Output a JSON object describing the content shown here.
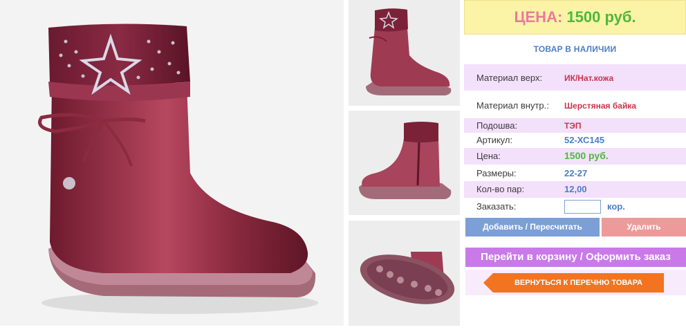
{
  "product": {
    "images": {
      "main_alt": "boot-main-photo",
      "thumbs": [
        "boot-side-view",
        "boot-inner-zip-view",
        "boot-sole-view"
      ]
    }
  },
  "price_box": {
    "label": "ЦЕНА:",
    "value": "1500 руб."
  },
  "stock_status": "ТОВАР В НАЛИЧИИ",
  "specs": [
    {
      "label": "Материал верх:",
      "value": "ИК/Нат.кожа"
    },
    {
      "label": "Материал внутр.:",
      "value": "Шерстяная байка"
    },
    {
      "label": "Подошва:",
      "value": "ТЭП"
    },
    {
      "label": "Артикул:",
      "value": "52-ХС145"
    },
    {
      "label": "Цена:",
      "value": "1500 руб."
    },
    {
      "label": "Размеры:",
      "value": "22-27"
    },
    {
      "label": "Кол-во пар:",
      "value": "12,00"
    }
  ],
  "order": {
    "label": "Заказать:",
    "value": "",
    "unit": "кор."
  },
  "buttons": {
    "add": "Добавить / Пересчитать",
    "delete": "Удалить",
    "cart": "Перейти в корзину / Оформить заказ",
    "back": "ВЕРНУТЬСЯ К ПЕРЕЧНЮ ТОВАРА"
  },
  "colors": {
    "price_bg": "#fbf3a6",
    "price_label": "#e87b9c",
    "price_value": "#4cb83d",
    "accent_blue": "#4a7fc4",
    "accent_red": "#c8334e",
    "row_alt": "#f3e0fb",
    "btn_add": "#7b9fd6",
    "btn_delete": "#ec9a9a",
    "btn_cart": "#c97ae8",
    "btn_back": "#f27420"
  }
}
